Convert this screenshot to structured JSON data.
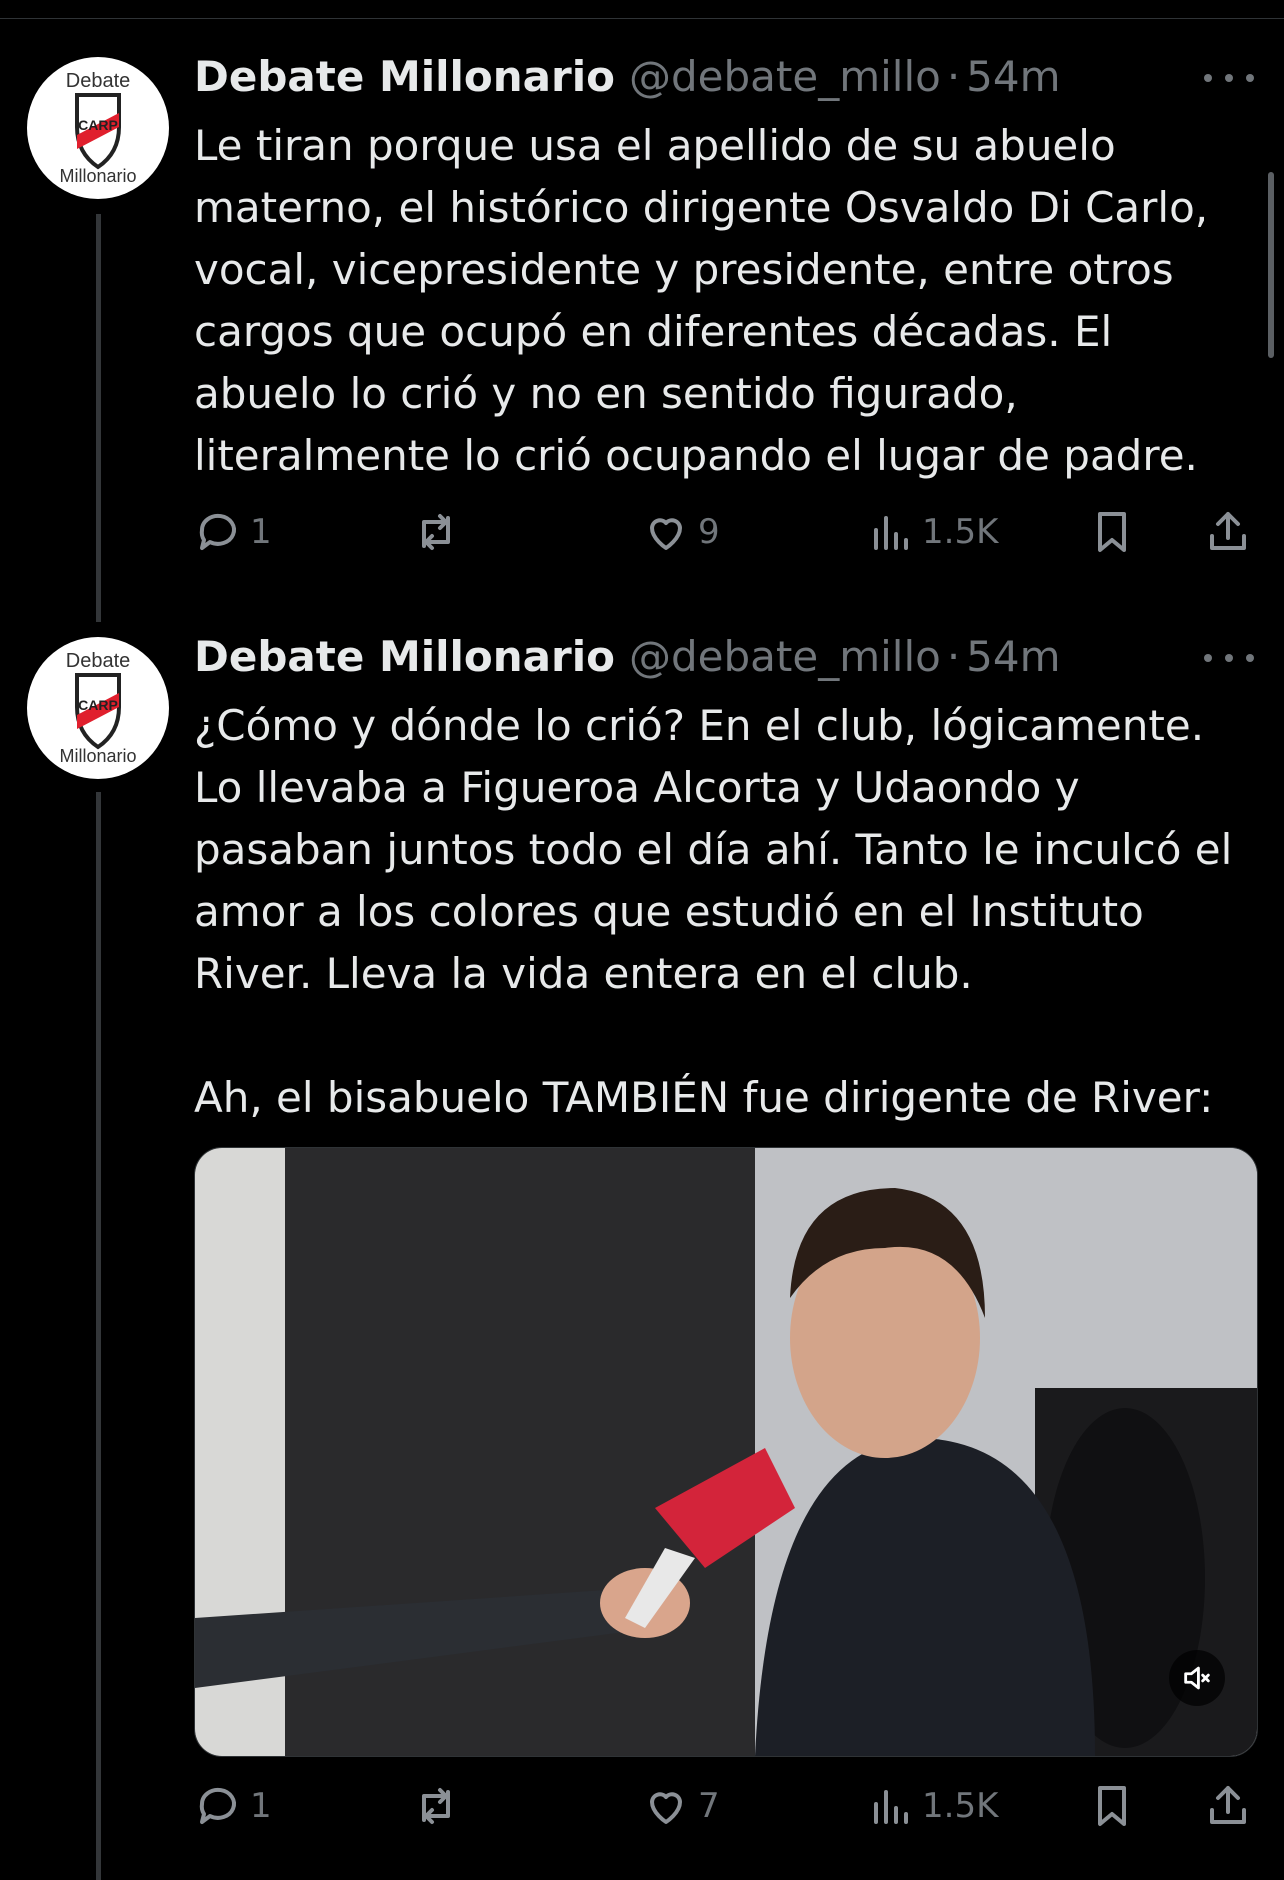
{
  "colors": {
    "background": "#000000",
    "text": "#e7e9ea",
    "muted": "#71767b",
    "border": "#2f3336"
  },
  "tweets": [
    {
      "name": "Debate Millonario",
      "handle": "@debate_millo",
      "time": "54m",
      "avatar": {
        "top": "Debate",
        "bottom": "Millonario"
      },
      "text": "Le tiran porque usa el apellido de su abuelo materno, el histórico dirigente Osvaldo Di Carlo, vocal, vicepresidente y presidente, entre otros cargos que ocupó en diferentes décadas. El abuelo lo crió y no en sentido figurado, literalmente lo crió ocupando el lugar de padre.",
      "replies": "1",
      "retweets": "",
      "likes": "9",
      "views": "1.5K"
    },
    {
      "name": "Debate Millonario",
      "handle": "@debate_millo",
      "time": "54m",
      "avatar": {
        "top": "Debate",
        "bottom": "Millonario"
      },
      "text": "¿Cómo y dónde lo crió? En el club, lógicamente. Lo llevaba a Figueroa Alcorta y Udaondo y pasaban juntos todo el día ahí. Tanto le inculcó el amor a los colores que estudió en el Instituto River. Lleva la vida entera en el club.\n\nAh, el bisabuelo TAMBIÉN fue dirigente de River:",
      "replies": "1",
      "retweets": "",
      "likes": "7",
      "views": "1.5K",
      "media": {
        "type": "video",
        "muted": true
      }
    }
  ],
  "icons": [
    "reply-icon",
    "retweet-icon",
    "like-icon",
    "views-icon",
    "bookmark-icon",
    "share-icon",
    "more-icon",
    "mute-icon"
  ]
}
